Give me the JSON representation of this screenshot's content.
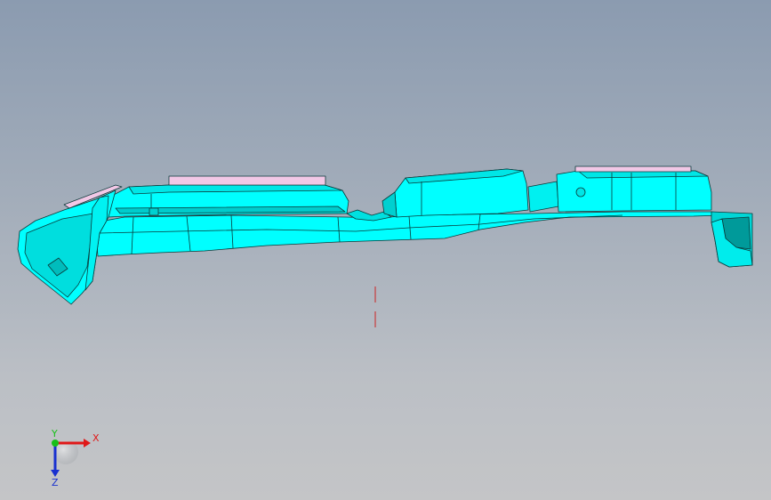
{
  "viewport": {
    "background_top": "#8b9bb0",
    "background_bottom": "#c4c5c7"
  },
  "model": {
    "fill_color": "#00ffff",
    "edge_color": "#0a3a3a",
    "pad_color": "#f2c8e6",
    "inner_fill": "#00d9d9"
  },
  "triad": {
    "x_label": "X",
    "y_label": "Y",
    "z_label": "Z",
    "x_color": "#e01818",
    "y_color": "#18c018",
    "z_color": "#1830d0"
  },
  "origin_marker_color": "#cc2222"
}
